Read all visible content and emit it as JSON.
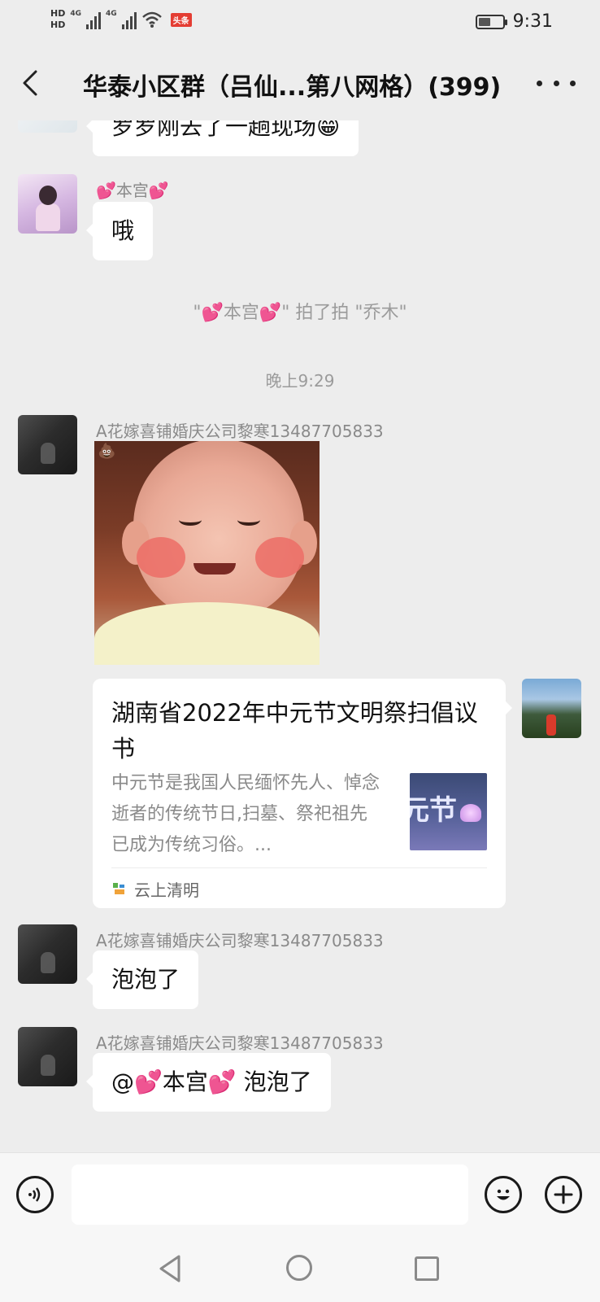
{
  "status_bar": {
    "hd1": "HD",
    "hd2": "HD",
    "net1": "4G",
    "net2": "4G",
    "app_badge": "头条",
    "time": "9:31",
    "battery_level": 0.5
  },
  "header": {
    "title": "华泰小区群（吕仙...第八网格）(399)"
  },
  "chat": {
    "partial_message": "罗罗刚去了一趟现场😁",
    "msg1": {
      "sender_prefix": "💕",
      "sender_name": "本宫",
      "sender_suffix": "💕",
      "text": "哦"
    },
    "pat_notice": {
      "text_a": "\"",
      "heart": "💕",
      "name": "本宫",
      "text_b": "\" 拍了拍 \"乔木\""
    },
    "timestamp": "晚上9:29",
    "msg2": {
      "sender": "A花嫁喜铺婚庆公司黎寒13487705833",
      "sticker_badge": "💩"
    },
    "link_card": {
      "title": "湖南省2022年中元节文明祭扫倡议书",
      "description": "中元节是我国人民缅怀先人、悼念逝者的传统节日,扫墓、祭祀祖先已成为传统习俗。...",
      "thumb_text": "元节",
      "source": "云上清明"
    },
    "msg3": {
      "sender": "A花嫁喜铺婚庆公司黎寒13487705833",
      "text": "泡泡了"
    },
    "msg4": {
      "sender": "A花嫁喜铺婚庆公司黎寒13487705833",
      "at": "@",
      "heart": "💕",
      "name": "本宫",
      "text": " 泡泡了"
    }
  },
  "input_bar": {
    "voice_icon": "voice-icon",
    "emoji_icon": "emoji-icon",
    "plus_icon": "plus-icon",
    "placeholder": ""
  }
}
